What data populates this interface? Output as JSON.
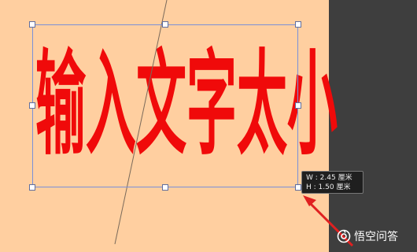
{
  "canvas": {
    "text_layer": {
      "characters": [
        "输",
        "入",
        "文",
        "字",
        "太",
        "小"
      ],
      "color": "#F00A0A"
    },
    "background_color": "#FFCFA0"
  },
  "transform_tooltip": {
    "width_label": "W :",
    "width_value": "2.45 厘米",
    "height_label": "H :",
    "height_value": "1.50 厘米"
  },
  "watermark": {
    "brand": "悟空问答",
    "icon": "wukong-logo-icon"
  },
  "annotation": {
    "arrow_color": "#E02020"
  }
}
